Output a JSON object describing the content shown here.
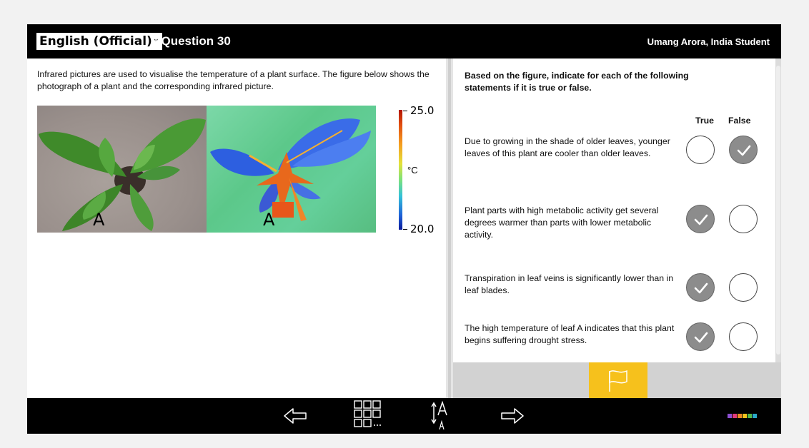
{
  "header": {
    "language": "English (Official)",
    "question_title": "| Question 30",
    "user": "Umang Arora, India Student"
  },
  "left": {
    "intro": "Infrared pictures are used to visualise the temperature of a plant surface. The figure below shows the photograph of a plant and the corresponding infrared picture.",
    "photo_label": "A",
    "infrared_label": "A",
    "colorbar": {
      "max": "25.0",
      "min": "20.0",
      "unit": "°C"
    }
  },
  "right": {
    "instruction": "Based on the figure, indicate for each of the following statements if it is true or false.",
    "true_header": "True",
    "false_header": "False",
    "statements": [
      {
        "text": "Due to growing in the shade of older leaves, younger leaves of this plant are cooler than older leaves.",
        "answer": "False"
      },
      {
        "text": "Plant parts with high metabolic activity get several degrees warmer than parts with lower metabolic activity.",
        "answer": "True"
      },
      {
        "text": "Transpiration in leaf veins is significantly lower than in leaf blades.",
        "answer": "True"
      },
      {
        "text": "The high temperature of leaf A indicates that this plant begins suffering drought stress.",
        "answer": "True"
      }
    ]
  },
  "icons": {
    "flag": "flag-icon",
    "back": "arrow-left-icon",
    "overview": "grid-icon",
    "font_size": "text-size-icon",
    "next": "arrow-right-icon",
    "logo": "logo-icon"
  },
  "colors": {
    "bar": "#000000",
    "flag_button": "#f6c11c",
    "selected_choice": "#8c8c8c"
  }
}
